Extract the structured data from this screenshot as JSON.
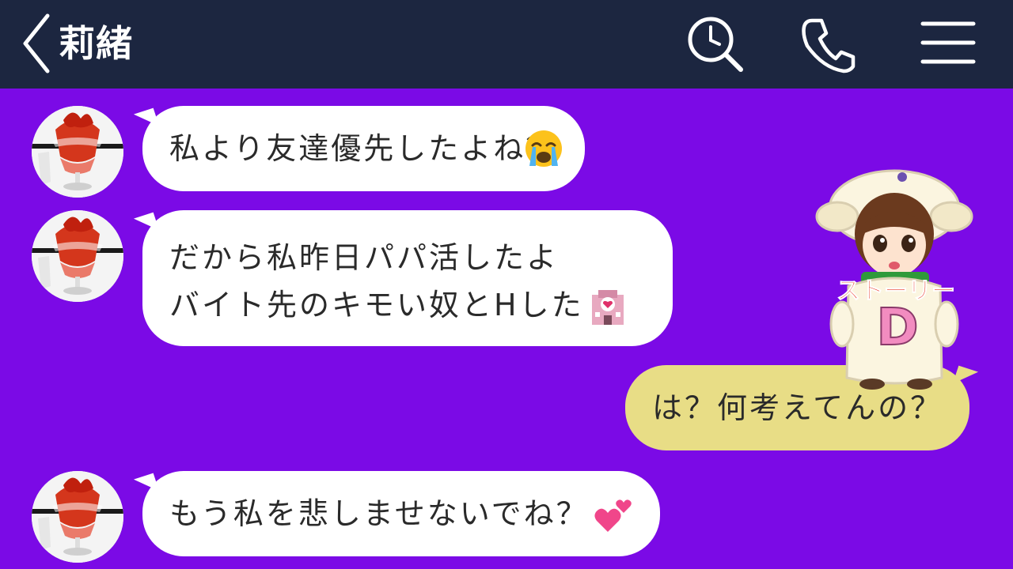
{
  "header": {
    "title": "莉緒",
    "icons": [
      "back-chevron-icon",
      "search-icon",
      "phone-icon",
      "menu-icon"
    ]
  },
  "messages": [
    {
      "direction": "incoming",
      "lines": [
        "私より友達優先したよね？"
      ],
      "emoji": "crying-face-emoji"
    },
    {
      "direction": "incoming",
      "lines": [
        "だから私昨日パパ活したよ",
        "バイト先のキモい奴とHした"
      ],
      "emoji": "love-hotel-emoji"
    },
    {
      "direction": "outgoing",
      "lines": [
        "は？何考えてんの？"
      ]
    },
    {
      "direction": "incoming",
      "lines": [
        "もう私を悲しませないでね？"
      ],
      "emoji": "two-hearts-emoji"
    }
  ],
  "sticker": {
    "text": "ストーリー",
    "letter": "D"
  },
  "colors": {
    "header_bg": "#1c2640",
    "chat_bg": "#7b0ae6",
    "incoming_bubble": "#ffffff",
    "outgoing_bubble": "#e8dd86"
  }
}
